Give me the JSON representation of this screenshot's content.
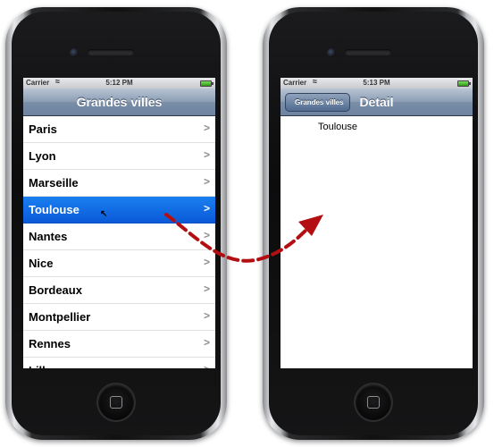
{
  "left_phone": {
    "status": {
      "carrier": "Carrier",
      "time": "5:12 PM"
    },
    "nav_title": "Grandes villes",
    "cities": [
      {
        "label": "Paris",
        "selected": false
      },
      {
        "label": "Lyon",
        "selected": false
      },
      {
        "label": "Marseille",
        "selected": false
      },
      {
        "label": "Toulouse",
        "selected": true
      },
      {
        "label": "Nantes",
        "selected": false
      },
      {
        "label": "Nice",
        "selected": false
      },
      {
        "label": "Bordeaux",
        "selected": false
      },
      {
        "label": "Montpellier",
        "selected": false
      },
      {
        "label": "Rennes",
        "selected": false
      },
      {
        "label": "Lille",
        "selected": false
      }
    ],
    "chevron": ">"
  },
  "right_phone": {
    "status": {
      "carrier": "Carrier",
      "time": "5:13 PM"
    },
    "back_label": "Grandes villes",
    "nav_title": "Detail",
    "detail_text": "Toulouse"
  },
  "colors": {
    "selected_row": "#0d63e0",
    "arrow": "#b30f12",
    "navbar": "#7d91ab"
  },
  "icons": [
    "wifi-icon",
    "battery-icon",
    "chevron-right-icon",
    "mouse-cursor-icon",
    "home-button-icon",
    "curved-arrow-icon"
  ]
}
